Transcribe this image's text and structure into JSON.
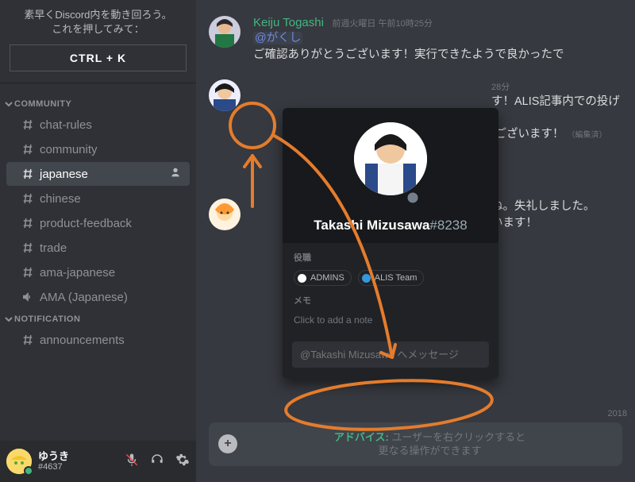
{
  "quick_switch": {
    "line1": "素早くDiscord内を動き回ろう。",
    "line2": "これを押してみて：",
    "button": "CTRL + K"
  },
  "sidebar": {
    "categories": [
      {
        "label": "COMMUNITY",
        "channels": [
          {
            "name": "chat-rules",
            "type": "text",
            "active": false
          },
          {
            "name": "community",
            "type": "text",
            "active": false
          },
          {
            "name": "japanese",
            "type": "text",
            "active": true
          },
          {
            "name": "chinese",
            "type": "text",
            "active": false
          },
          {
            "name": "product-feedback",
            "type": "text",
            "active": false
          },
          {
            "name": "trade",
            "type": "text",
            "active": false
          },
          {
            "name": "ama-japanese",
            "type": "text",
            "active": false
          },
          {
            "name": "AMA (Japanese)",
            "type": "voice",
            "active": false
          }
        ]
      },
      {
        "label": "NOTIFICATION",
        "channels": [
          {
            "name": "announcements",
            "type": "text",
            "active": false
          }
        ]
      }
    ]
  },
  "user_bar": {
    "name": "ゆうき",
    "tag": "#4637",
    "status": "online"
  },
  "messages": [
    {
      "author": "Keiju Togashi",
      "author_color": "green",
      "timestamp": "前週火曜日 午前10時25分",
      "mention": "@がくし",
      "text": "ご確認ありがとうございます！実行できたようで良かったで"
    },
    {
      "author": "",
      "author_color": "",
      "timestamp": "28分",
      "text_frag_1": "す！ALIS記事内での投げ",
      "text_frag_2": "うございます！",
      "edited": "（編集済）"
    },
    {
      "author": "",
      "text_frag_1": "ね。失礼しました。",
      "text_frag_2": "います！"
    }
  ],
  "date_divider": "2018",
  "popout": {
    "name": "Takashi Mizusawa",
    "discriminator": "#8238",
    "roles_label": "役職",
    "roles": [
      {
        "name": "ADMINS",
        "color": "#ffffff"
      },
      {
        "name": "ALIS Team",
        "color": "#3498db"
      }
    ],
    "note_label": "メモ",
    "note_placeholder": "Click to add a note",
    "dm_placeholder": "@Takashi Mizusawa へメッセージ"
  },
  "composer": {
    "tip_bold": "アドバイス:",
    "tip_rest": "ユーザーを右クリックすると",
    "tip_line2": "更なる操作ができます"
  },
  "annotation": {
    "color": "#e47c2d"
  }
}
